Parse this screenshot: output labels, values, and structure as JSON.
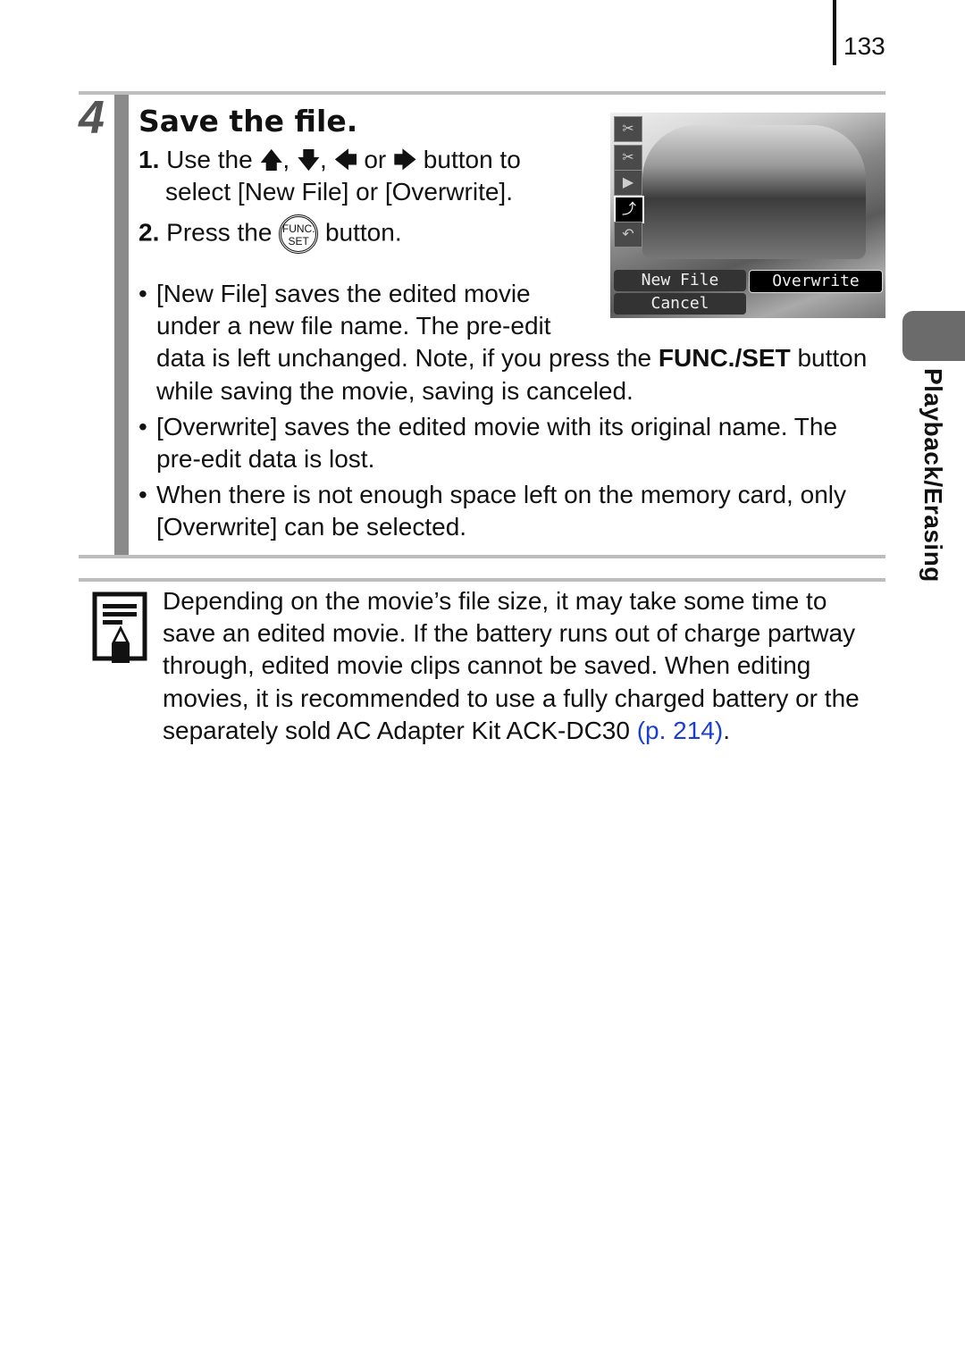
{
  "page_number": "133",
  "step": {
    "number": "4",
    "title": "Save the file.",
    "line1a": "1.",
    "line1b": " Use the ",
    "sep1": ", ",
    "sep2": ", ",
    "or": " or ",
    "line1c": " button to",
    "line1d": "select [New File] or [Overwrite].",
    "line2a": "2.",
    "line2b": " Press the ",
    "line2c": " button.",
    "func_top": "FUNC.",
    "func_bot": "SET",
    "bullets": [
      {
        "lines": [
          "[New File] saves the edited movie",
          "under a new file name. The pre-edit"
        ],
        "l3a": "data is left unchanged. Note, if you press the ",
        "l3b": "FUNC./SET",
        "l3c": " button",
        "l4": "while saving the movie, saving is canceled."
      },
      {
        "lines": [
          "[Overwrite] saves the edited movie with its original name. The",
          "pre-edit data is lost."
        ]
      },
      {
        "lines": [
          "When there is not enough space left on the memory card, only",
          "[Overwrite] can be selected."
        ]
      }
    ]
  },
  "screen": {
    "new_file": "New File",
    "overwrite": "Overwrite",
    "cancel": "Cancel",
    "selected": "Overwrite"
  },
  "note": {
    "lines": [
      "Depending on the movie’s file size, it may take some time to",
      "save an edited movie. If the battery runs out of charge partway",
      "through, edited movie clips cannot be saved. When editing",
      "movies, it is recommended to use a fully charged battery or the"
    ],
    "last": "separately sold AC Adapter Kit ACK-DC30 ",
    "link": "(p. 214)",
    "end": ".",
    "link_color": "#1a3fd0"
  },
  "side_tab": "Playback/Erasing"
}
